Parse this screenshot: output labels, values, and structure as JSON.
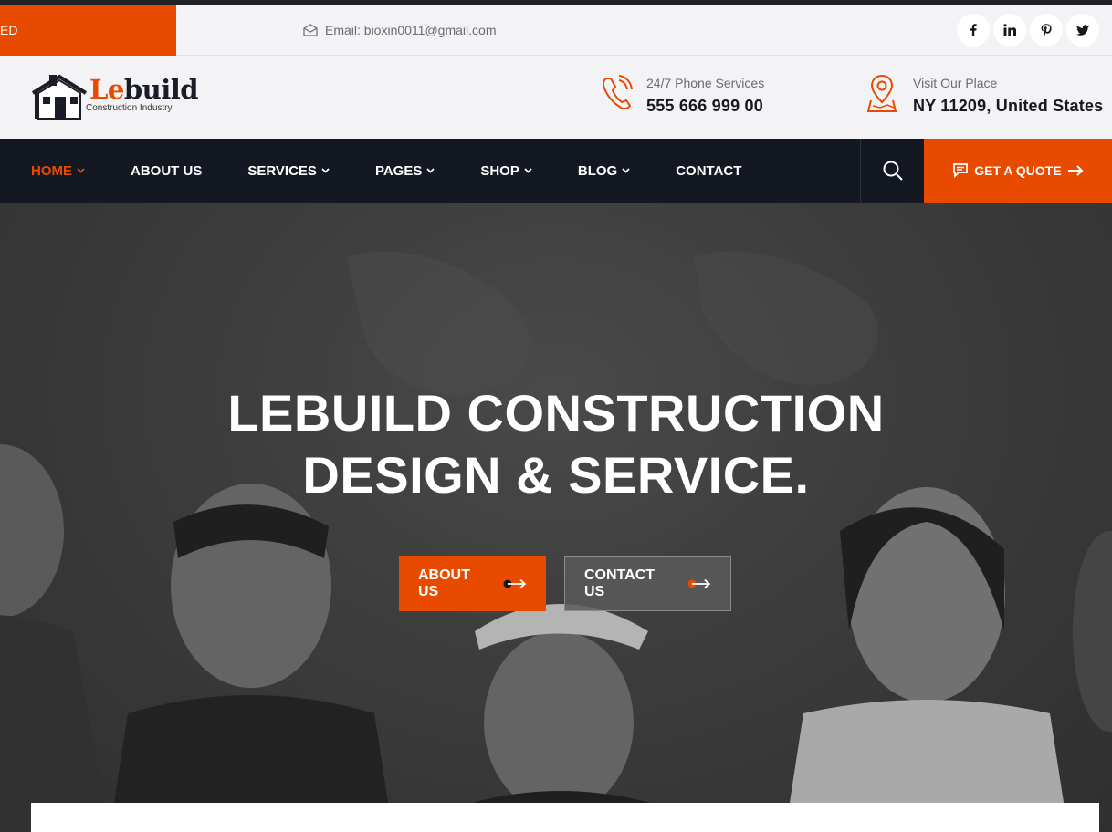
{
  "topbar": {
    "badge_text": "ED",
    "email": "Email: bioxin0011@gmail.com",
    "socials": [
      "facebook-icon",
      "linkedin-icon",
      "pinterest-icon",
      "twitter-icon"
    ]
  },
  "header": {
    "logo_word_accent": "Le",
    "logo_word_rest": "build",
    "logo_tagline": "Construction Industry",
    "phone_label": "24/7 Phone Services",
    "phone_value": "555 666 999 00",
    "place_label": "Visit Our Place",
    "place_value": "NY 11209, United States"
  },
  "nav": {
    "items": [
      {
        "label": "HOME",
        "dropdown": true,
        "active": true
      },
      {
        "label": "ABOUT US",
        "dropdown": false
      },
      {
        "label": "SERVICES",
        "dropdown": true
      },
      {
        "label": "PAGES",
        "dropdown": true
      },
      {
        "label": "SHOP",
        "dropdown": true
      },
      {
        "label": "BLOG",
        "dropdown": true
      },
      {
        "label": "CONTACT",
        "dropdown": false
      }
    ],
    "quote_label": "GET A QUOTE"
  },
  "hero": {
    "title_line1": "LEBUILD CONSTRUCTION",
    "title_line2": "DESIGN & SERVICE.",
    "about_label": "ABOUT US",
    "contact_label": "CONTACT US"
  },
  "colors": {
    "accent": "#e84b00",
    "nav_bg": "#141823",
    "page_bg": "#f3f3f5"
  }
}
